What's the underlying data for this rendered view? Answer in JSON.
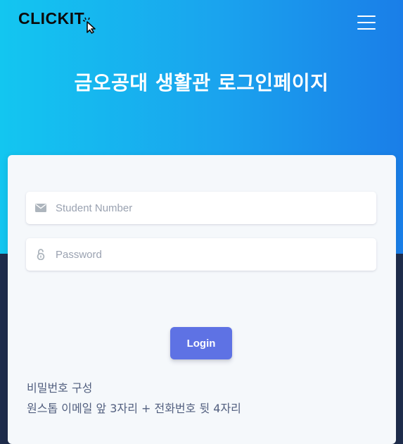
{
  "header": {
    "logo_text": "CLICKIT",
    "menu_icon": "hamburger-menu-icon",
    "title": "금오공대 생활관 로그인페이지"
  },
  "login_form": {
    "student_number": {
      "placeholder": "Student Number",
      "value": "",
      "icon": "envelope-icon"
    },
    "password": {
      "placeholder": "Password",
      "value": "",
      "icon": "unlock-icon"
    },
    "login_label": "Login"
  },
  "hint": {
    "line1": "비밀번호 구성",
    "line2": "원스톱 이메일 앞 3자리 + 전화번호 뒷 4자리"
  },
  "colors": {
    "gradient_start": "#13c6f0",
    "gradient_end": "#1a7ee8",
    "background_dark": "#1f2d4c",
    "card": "#f5f8fb",
    "primary_button": "#5e72e4",
    "muted_text": "#525f7f"
  }
}
